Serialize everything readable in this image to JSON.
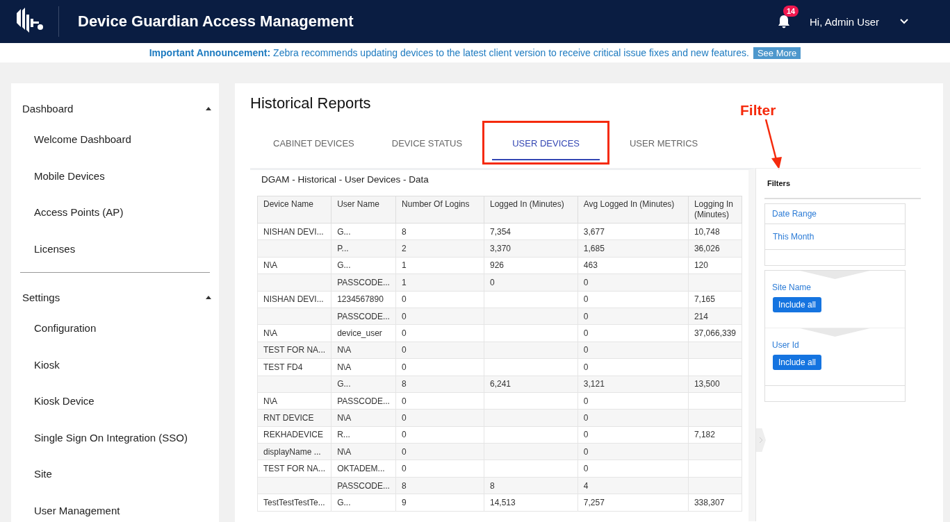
{
  "header": {
    "title": "Device Guardian Access Management",
    "notification_count": "14",
    "user": "Hi, Admin User"
  },
  "announcement": {
    "label": "Important Announcement:",
    "text": "Zebra recommends updating devices to the latest client version to receive critical issue fixes and new features.",
    "button": "See More"
  },
  "sidebar": {
    "sections": [
      {
        "title": "Dashboard",
        "expanded": true,
        "items": [
          "Welcome Dashboard",
          "Mobile Devices",
          "Access Points (AP)",
          "Licenses"
        ]
      },
      {
        "title": "Settings",
        "expanded": true,
        "items": [
          "Configuration",
          "Kiosk",
          "Kiosk Device",
          "Single Sign On Integration (SSO)",
          "Site",
          "User Management"
        ]
      }
    ]
  },
  "page_title": "Historical Reports",
  "tabs": [
    {
      "label": "CABINET DEVICES",
      "selected": false
    },
    {
      "label": "DEVICE STATUS",
      "selected": false
    },
    {
      "label": "USER DEVICES",
      "selected": true
    },
    {
      "label": "USER METRICS",
      "selected": false
    }
  ],
  "annotation": {
    "label": "Filter"
  },
  "table": {
    "title": "DGAM - Historical - User Devices - Data",
    "columns": [
      "Device Name",
      "User Name",
      "Number Of Logins",
      "Logged In (Minutes)",
      "Avg Logged In (Minutes)",
      "Logging In (Minutes)"
    ],
    "rows": [
      [
        "NISHAN DEVI...",
        "G...",
        "8",
        "7,354",
        "3,677",
        "10,748"
      ],
      [
        "",
        "P...",
        "2",
        "3,370",
        "1,685",
        "36,026"
      ],
      [
        "N\\A",
        "G...",
        "1",
        "926",
        "463",
        "120"
      ],
      [
        "",
        "PASSCODE...",
        "1",
        "0",
        "0",
        ""
      ],
      [
        "NISHAN DEVI...",
        "1234567890",
        "0",
        "",
        "0",
        "7,165"
      ],
      [
        "",
        "PASSCODE...",
        "0",
        "",
        "0",
        "214"
      ],
      [
        "N\\A",
        "device_user",
        "0",
        "",
        "0",
        "37,066,339"
      ],
      [
        "TEST FOR NA...",
        "N\\A",
        "0",
        "",
        "0",
        ""
      ],
      [
        "TEST FD4",
        "N\\A",
        "0",
        "",
        "0",
        ""
      ],
      [
        "",
        "G...",
        "8",
        "6,241",
        "3,121",
        "13,500"
      ],
      [
        "N\\A",
        "PASSCODE...",
        "0",
        "",
        "0",
        ""
      ],
      [
        "RNT DEVICE",
        "N\\A",
        "0",
        "",
        "0",
        ""
      ],
      [
        "REKHADEVICE",
        "R...",
        "0",
        "",
        "0",
        "7,182"
      ],
      [
        "displayName ...",
        "N\\A",
        "0",
        "",
        "0",
        ""
      ],
      [
        "TEST FOR NA...",
        "OKTADEM...",
        "0",
        "",
        "0",
        ""
      ],
      [
        "",
        "PASSCODE...",
        "8",
        "8",
        "4",
        ""
      ],
      [
        "TestTestTestTe...",
        "G...",
        "9",
        "14,513",
        "7,257",
        "338,307"
      ]
    ]
  },
  "filters": {
    "title": "Filters",
    "groups": [
      {
        "kind": "value",
        "label": "Date Range",
        "value": "This Month"
      },
      {
        "kind": "button",
        "label": "Site Name",
        "button": "Include all"
      },
      {
        "kind": "button",
        "label": "User Id",
        "button": "Include all"
      }
    ]
  }
}
